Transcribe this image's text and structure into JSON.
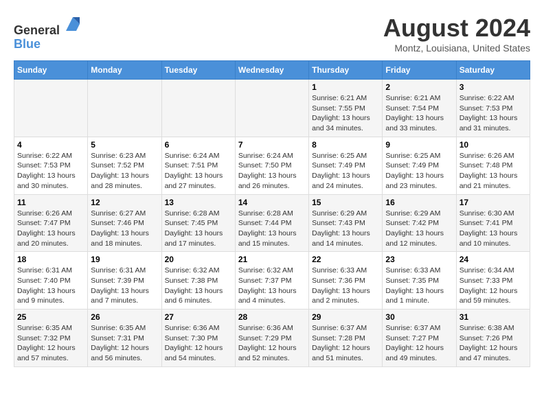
{
  "header": {
    "logo_line1": "General",
    "logo_line2": "Blue",
    "month_title": "August 2024",
    "location": "Montz, Louisiana, United States"
  },
  "calendar": {
    "days_of_week": [
      "Sunday",
      "Monday",
      "Tuesday",
      "Wednesday",
      "Thursday",
      "Friday",
      "Saturday"
    ],
    "weeks": [
      [
        {
          "day": "",
          "info": ""
        },
        {
          "day": "",
          "info": ""
        },
        {
          "day": "",
          "info": ""
        },
        {
          "day": "",
          "info": ""
        },
        {
          "day": "1",
          "info": "Sunrise: 6:21 AM\nSunset: 7:55 PM\nDaylight: 13 hours\nand 34 minutes."
        },
        {
          "day": "2",
          "info": "Sunrise: 6:21 AM\nSunset: 7:54 PM\nDaylight: 13 hours\nand 33 minutes."
        },
        {
          "day": "3",
          "info": "Sunrise: 6:22 AM\nSunset: 7:53 PM\nDaylight: 13 hours\nand 31 minutes."
        }
      ],
      [
        {
          "day": "4",
          "info": "Sunrise: 6:22 AM\nSunset: 7:53 PM\nDaylight: 13 hours\nand 30 minutes."
        },
        {
          "day": "5",
          "info": "Sunrise: 6:23 AM\nSunset: 7:52 PM\nDaylight: 13 hours\nand 28 minutes."
        },
        {
          "day": "6",
          "info": "Sunrise: 6:24 AM\nSunset: 7:51 PM\nDaylight: 13 hours\nand 27 minutes."
        },
        {
          "day": "7",
          "info": "Sunrise: 6:24 AM\nSunset: 7:50 PM\nDaylight: 13 hours\nand 26 minutes."
        },
        {
          "day": "8",
          "info": "Sunrise: 6:25 AM\nSunset: 7:49 PM\nDaylight: 13 hours\nand 24 minutes."
        },
        {
          "day": "9",
          "info": "Sunrise: 6:25 AM\nSunset: 7:49 PM\nDaylight: 13 hours\nand 23 minutes."
        },
        {
          "day": "10",
          "info": "Sunrise: 6:26 AM\nSunset: 7:48 PM\nDaylight: 13 hours\nand 21 minutes."
        }
      ],
      [
        {
          "day": "11",
          "info": "Sunrise: 6:26 AM\nSunset: 7:47 PM\nDaylight: 13 hours\nand 20 minutes."
        },
        {
          "day": "12",
          "info": "Sunrise: 6:27 AM\nSunset: 7:46 PM\nDaylight: 13 hours\nand 18 minutes."
        },
        {
          "day": "13",
          "info": "Sunrise: 6:28 AM\nSunset: 7:45 PM\nDaylight: 13 hours\nand 17 minutes."
        },
        {
          "day": "14",
          "info": "Sunrise: 6:28 AM\nSunset: 7:44 PM\nDaylight: 13 hours\nand 15 minutes."
        },
        {
          "day": "15",
          "info": "Sunrise: 6:29 AM\nSunset: 7:43 PM\nDaylight: 13 hours\nand 14 minutes."
        },
        {
          "day": "16",
          "info": "Sunrise: 6:29 AM\nSunset: 7:42 PM\nDaylight: 13 hours\nand 12 minutes."
        },
        {
          "day": "17",
          "info": "Sunrise: 6:30 AM\nSunset: 7:41 PM\nDaylight: 13 hours\nand 10 minutes."
        }
      ],
      [
        {
          "day": "18",
          "info": "Sunrise: 6:31 AM\nSunset: 7:40 PM\nDaylight: 13 hours\nand 9 minutes."
        },
        {
          "day": "19",
          "info": "Sunrise: 6:31 AM\nSunset: 7:39 PM\nDaylight: 13 hours\nand 7 minutes."
        },
        {
          "day": "20",
          "info": "Sunrise: 6:32 AM\nSunset: 7:38 PM\nDaylight: 13 hours\nand 6 minutes."
        },
        {
          "day": "21",
          "info": "Sunrise: 6:32 AM\nSunset: 7:37 PM\nDaylight: 13 hours\nand 4 minutes."
        },
        {
          "day": "22",
          "info": "Sunrise: 6:33 AM\nSunset: 7:36 PM\nDaylight: 13 hours\nand 2 minutes."
        },
        {
          "day": "23",
          "info": "Sunrise: 6:33 AM\nSunset: 7:35 PM\nDaylight: 13 hours\nand 1 minute."
        },
        {
          "day": "24",
          "info": "Sunrise: 6:34 AM\nSunset: 7:33 PM\nDaylight: 12 hours\nand 59 minutes."
        }
      ],
      [
        {
          "day": "25",
          "info": "Sunrise: 6:35 AM\nSunset: 7:32 PM\nDaylight: 12 hours\nand 57 minutes."
        },
        {
          "day": "26",
          "info": "Sunrise: 6:35 AM\nSunset: 7:31 PM\nDaylight: 12 hours\nand 56 minutes."
        },
        {
          "day": "27",
          "info": "Sunrise: 6:36 AM\nSunset: 7:30 PM\nDaylight: 12 hours\nand 54 minutes."
        },
        {
          "day": "28",
          "info": "Sunrise: 6:36 AM\nSunset: 7:29 PM\nDaylight: 12 hours\nand 52 minutes."
        },
        {
          "day": "29",
          "info": "Sunrise: 6:37 AM\nSunset: 7:28 PM\nDaylight: 12 hours\nand 51 minutes."
        },
        {
          "day": "30",
          "info": "Sunrise: 6:37 AM\nSunset: 7:27 PM\nDaylight: 12 hours\nand 49 minutes."
        },
        {
          "day": "31",
          "info": "Sunrise: 6:38 AM\nSunset: 7:26 PM\nDaylight: 12 hours\nand 47 minutes."
        }
      ]
    ]
  }
}
